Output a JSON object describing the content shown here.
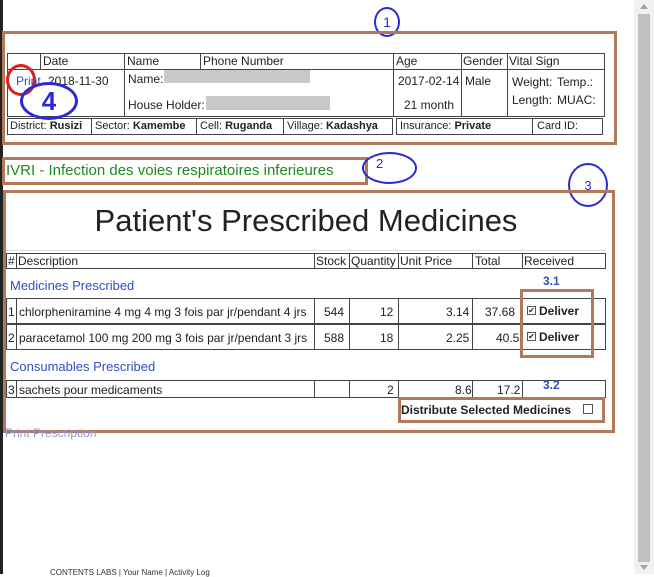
{
  "annotations": {
    "n1": "1",
    "n2": "2",
    "n3": "3",
    "n4": "4",
    "n31": "3.1",
    "n32": "3.2"
  },
  "header": {
    "col_date": "Date",
    "col_name": "Name",
    "col_phone": "Phone Number",
    "col_age": "Age",
    "col_gender": "Gender",
    "col_vital": "Vital Sign",
    "print_link": "Print",
    "date_value": "2018-11-30",
    "name_label": "Name:",
    "house_holder_label": "House Holder:",
    "age_date": "2017-02-14",
    "age_months": "21 month",
    "gender": "Male",
    "weight_label": "Weight:",
    "temp_label": "Temp.:",
    "length_label": "Length:",
    "muac_label": "MUAC:",
    "district_label": "District:",
    "district_value": "Rusizi",
    "sector_label": "Sector:",
    "sector_value": "Kamembe",
    "cell_label": "Cell:",
    "cell_value": "Ruganda",
    "village_label": "Village:",
    "village_value": "Kadashya",
    "insurance_label": "Insurance:",
    "insurance_value": "Private",
    "card_label": "Card ID:"
  },
  "diagnosis": "IVRI - Infection des voies respiratoires inferieures",
  "prescription": {
    "title": "Patient's Prescribed Medicines",
    "columns": {
      "num": "#",
      "desc": "Description",
      "stock": "Stock",
      "qty": "Quantity",
      "unit": "Unit Price",
      "total": "Total",
      "received": "Received"
    },
    "medicines_heading": "Medicines Prescribed",
    "consumables_heading": "Consumables Prescribed",
    "medicines": [
      {
        "num": "1",
        "desc": "chlorpheniramine 4 mg 4 mg 3 fois par jr/pendant 4 jrs",
        "stock": "544",
        "qty": "12",
        "unit": "3.14",
        "total": "37.68",
        "deliver": "Deliver"
      },
      {
        "num": "2",
        "desc": "paracetamol 100 mg 200 mg 3 fois par jr/pendant 3 jrs",
        "stock": "588",
        "qty": "18",
        "unit": "2.25",
        "total": "40.5",
        "deliver": "Deliver"
      }
    ],
    "consumables": [
      {
        "num": "3",
        "desc": "sachets pour medicaments",
        "stock": "",
        "qty": "2",
        "unit": "8.6",
        "total": "17.2"
      }
    ],
    "distribute_label": "Distribute Selected Medicines",
    "print_prescription": "Print Prescription"
  },
  "footer_text": "CONTENTS LABS | Your Name | Activity Log"
}
